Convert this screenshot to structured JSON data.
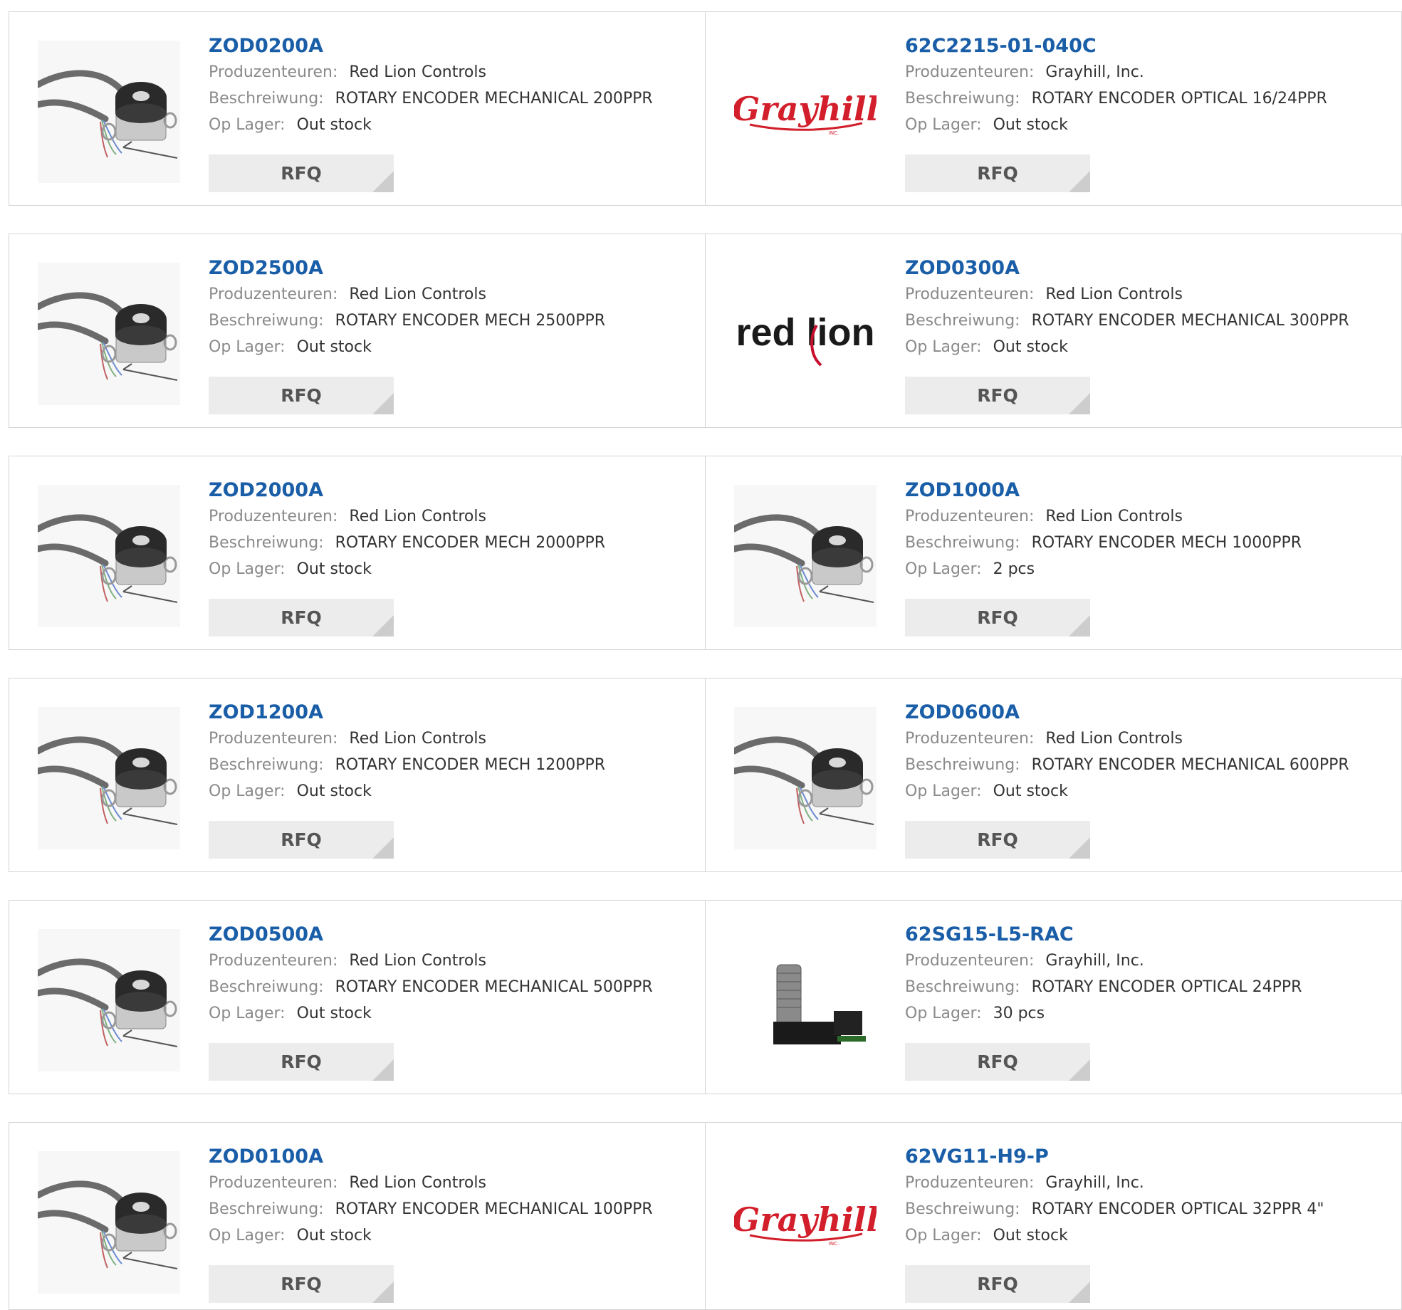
{
  "labels": {
    "manufacturer": "Produzenteuren:",
    "description": "Beschreiwung:",
    "stock": "Op Lager:",
    "rfq": "RFQ"
  },
  "products": [
    {
      "part": "ZOD0200A",
      "manufacturer": "Red Lion Controls",
      "description": "ROTARY ENCODER MECHANICAL 200PPR",
      "stock": "Out stock",
      "image": "encoder-photo"
    },
    {
      "part": "62C2215-01-040C",
      "manufacturer": "Grayhill, Inc.",
      "description": "ROTARY ENCODER OPTICAL 16/24PPR",
      "stock": "Out stock",
      "image": "grayhill-logo"
    },
    {
      "part": "ZOD2500A",
      "manufacturer": "Red Lion Controls",
      "description": "ROTARY ENCODER MECH 2500PPR",
      "stock": "Out stock",
      "image": "encoder-photo"
    },
    {
      "part": "ZOD0300A",
      "manufacturer": "Red Lion Controls",
      "description": "ROTARY ENCODER MECHANICAL 300PPR",
      "stock": "Out stock",
      "image": "red-lion-logo"
    },
    {
      "part": "ZOD2000A",
      "manufacturer": "Red Lion Controls",
      "description": "ROTARY ENCODER MECH 2000PPR",
      "stock": "Out stock",
      "image": "encoder-photo"
    },
    {
      "part": "ZOD1000A",
      "manufacturer": "Red Lion Controls",
      "description": "ROTARY ENCODER MECH 1000PPR",
      "stock": "2 pcs",
      "image": "encoder-photo"
    },
    {
      "part": "ZOD1200A",
      "manufacturer": "Red Lion Controls",
      "description": "ROTARY ENCODER MECH 1200PPR",
      "stock": "Out stock",
      "image": "encoder-photo"
    },
    {
      "part": "ZOD0600A",
      "manufacturer": "Red Lion Controls",
      "description": "ROTARY ENCODER MECHANICAL 600PPR",
      "stock": "Out stock",
      "image": "encoder-photo"
    },
    {
      "part": "ZOD0500A",
      "manufacturer": "Red Lion Controls",
      "description": "ROTARY ENCODER MECHANICAL 500PPR",
      "stock": "Out stock",
      "image": "encoder-photo"
    },
    {
      "part": "62SG15-L5-RAC",
      "manufacturer": "Grayhill, Inc.",
      "description": "ROTARY ENCODER OPTICAL 24PPR",
      "stock": "30 pcs",
      "image": "shaft-encoder-photo"
    },
    {
      "part": "ZOD0100A",
      "manufacturer": "Red Lion Controls",
      "description": "ROTARY ENCODER MECHANICAL 100PPR",
      "stock": "Out stock",
      "image": "encoder-photo"
    },
    {
      "part": "62VG11-H9-P",
      "manufacturer": "Grayhill, Inc.",
      "description": "ROTARY ENCODER OPTICAL 32PPR 4\"",
      "stock": "Out stock",
      "image": "grayhill-logo"
    }
  ],
  "logos": {
    "grayhill": {
      "text": "Grayhill",
      "sub": "INC.",
      "color": "#d21f2b"
    },
    "red_lion": {
      "text": "red lion",
      "color": "#1a1a1a",
      "accent": "#c8102e"
    }
  }
}
